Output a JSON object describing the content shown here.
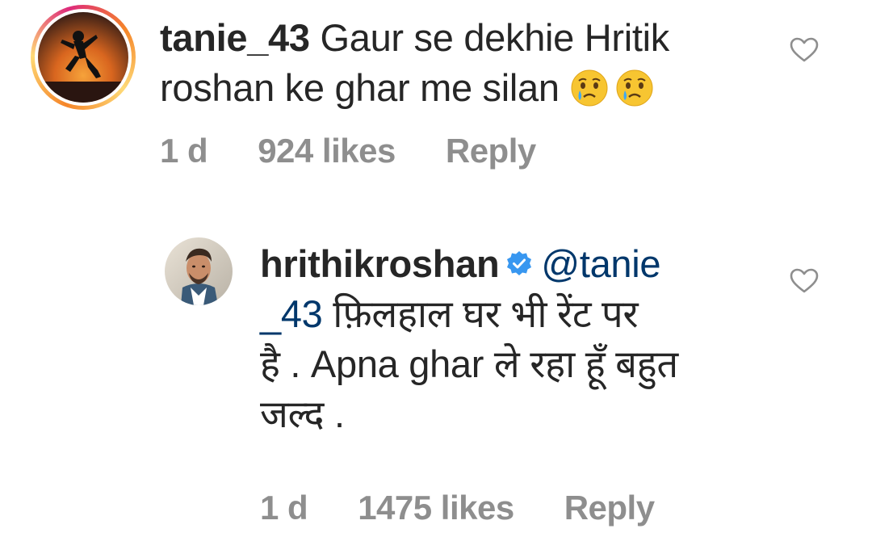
{
  "comments": [
    {
      "username": "tanie_43",
      "text_line1": " Gaur se dekhie Hritik",
      "text_line2": "roshan ke ghar me silan ",
      "emoji_names": [
        "crying-face-emoji",
        "crying-face-emoji"
      ],
      "time": "1 d",
      "likes": "924 likes",
      "reply_label": "Reply",
      "avatar_icon": "jumping-silhouette-avatar",
      "like_icon": "heart-outline-icon"
    },
    {
      "username": "hrithikroshan",
      "verified": true,
      "mention_part1": "@tanie",
      "mention_part2": "_43",
      "text_line2_rest": " फ़िलहाल घर भी रेंट पर",
      "text_line3": "है . Apna ghar ले रहा हूँ बहुत",
      "text_line4": "जल्द .",
      "time": "1 d",
      "likes": "1475 likes",
      "reply_label": "Reply",
      "avatar_icon": "profile-photo-avatar",
      "like_icon": "heart-outline-icon"
    }
  ],
  "colors": {
    "text": "#262626",
    "meta": "#8e8e8e",
    "mention": "#00376b",
    "verified": "#3897f0"
  }
}
